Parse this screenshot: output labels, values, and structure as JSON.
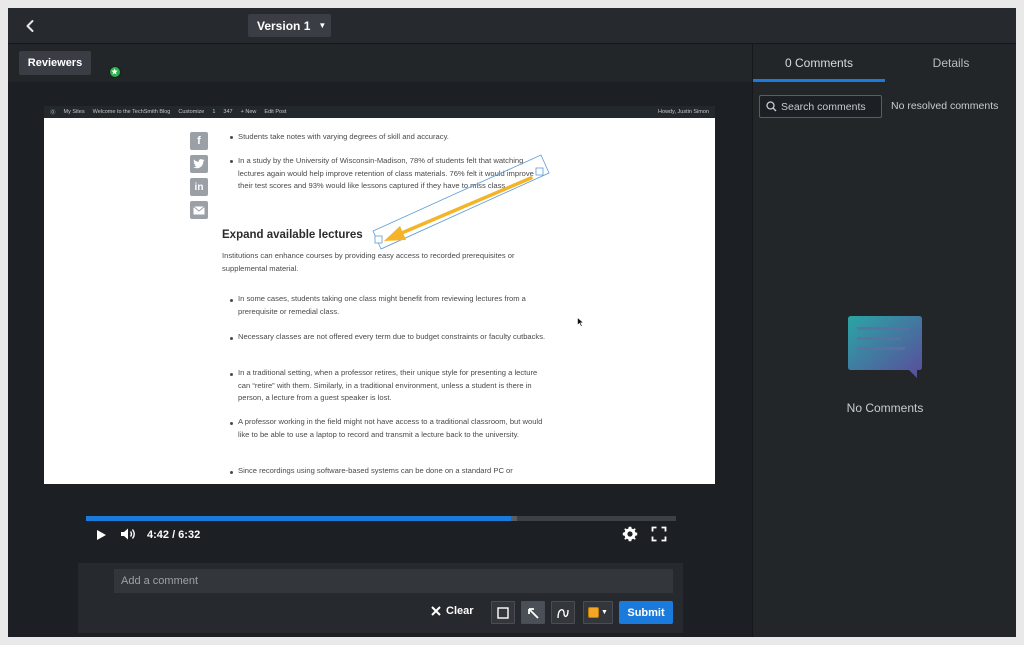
{
  "topbar": {
    "version_label": "Version 1"
  },
  "reviewers": {
    "button_label": "Reviewers"
  },
  "browser_bar": {
    "items": [
      "My Sites",
      "Welcome to the TechSmith Blog",
      "Customize",
      "1",
      "347",
      "+ New",
      "Edit Post"
    ],
    "greeting": "Howdy, Justin Simon"
  },
  "document": {
    "bullets_top": [
      "Students take notes with varying degrees of skill and accuracy.",
      "In a study by the University of Wisconsin-Madison, 78% of students felt that watching lectures again would help improve retention of class materials. 76% felt it would improve their test scores and 93% would like lessons captured if they have to miss class."
    ],
    "heading": "Expand available lectures",
    "intro": "Institutions can enhance courses by providing easy access to recorded prerequisites or supplemental material.",
    "bullets": [
      "In some cases, students taking one class might benefit from reviewing lectures from a prerequisite or remedial class.",
      "Necessary classes are not offered every term due to budget constraints or faculty cutbacks.",
      "In a traditional setting, when a professor retires, their unique style for presenting a lecture can “retire” with them. Similarly, in a traditional environment, unless a student is there in person, a lecture from a guest speaker is lost.",
      "A professor working in the field might not have access to a traditional classroom, but would like to be able to use a laptop to record and transmit a lecture back to the university.",
      "Since recordings using software-based systems can be done on a standard PC or"
    ]
  },
  "player": {
    "time": "4:42 / 6:32",
    "progress_fraction": 0.72,
    "buffer_fraction": 0.73
  },
  "composer": {
    "placeholder": "Add a comment",
    "clear_label": "Clear",
    "submit_label": "Submit",
    "annotation_color": "#f5a623"
  },
  "panel": {
    "tab_comments": "0 Comments",
    "tab_details": "Details",
    "search_placeholder": "Search comments",
    "resolved_text": "No resolved comments",
    "empty_text": "No Comments"
  },
  "colors": {
    "accent": "#1a7bdc",
    "avatar": "#2bb24c"
  }
}
